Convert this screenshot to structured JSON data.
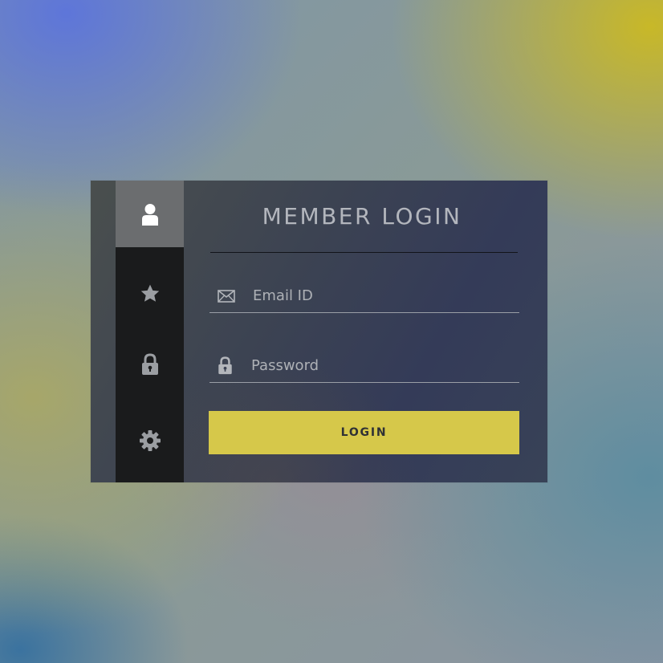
{
  "login_panel": {
    "title": "MEMBER LOGIN",
    "email": {
      "placeholder": "Email ID",
      "value": "",
      "icon": "envelope-icon"
    },
    "password": {
      "placeholder": "Password",
      "value": "",
      "icon": "lock-icon"
    },
    "login_button_label": "LOGIN"
  },
  "side_rail": {
    "items": [
      {
        "icon": "user-icon",
        "active": true
      },
      {
        "icon": "star-icon",
        "active": false
      },
      {
        "icon": "lock-icon",
        "active": false
      },
      {
        "icon": "gear-icon",
        "active": false
      }
    ]
  },
  "colors": {
    "accent": "#d6c84a",
    "rail": "#1a1b1c",
    "rail_active": "#6b6d6f",
    "icon": "#9b9ea2",
    "text": "#b3b6bd"
  }
}
